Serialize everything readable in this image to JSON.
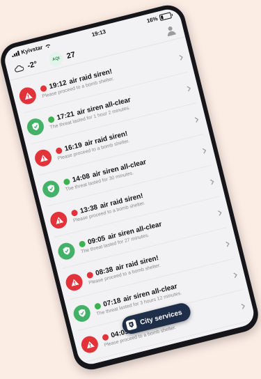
{
  "status": {
    "carrier": "Kyivstar",
    "time": "19:13",
    "battery": "16%"
  },
  "header": {
    "temperature": "-2°",
    "aqi_label": "AQI",
    "aqi_value": "27"
  },
  "alerts": [
    {
      "kind": "siren",
      "time": "19:12",
      "title": "air raid siren!",
      "subtitle": "Please proceed to a bomb shelter."
    },
    {
      "kind": "clear",
      "time": "17:21",
      "title": "air siren all-clear",
      "subtitle": "The threat lasted for 1 hour 2 minutes."
    },
    {
      "kind": "siren",
      "time": "16:19",
      "title": "air raid siren!",
      "subtitle": "Please proceed to a bomb shelter."
    },
    {
      "kind": "clear",
      "time": "14:08",
      "title": "air siren all-clear",
      "subtitle": "The threat lasted for 30 minutes."
    },
    {
      "kind": "siren",
      "time": "13:38",
      "title": "air raid siren!",
      "subtitle": "Please proceed to a bomb shelter."
    },
    {
      "kind": "clear",
      "time": "09:05",
      "title": "air siren all-clear",
      "subtitle": "The threat lasted for 27 minutes."
    },
    {
      "kind": "siren",
      "time": "08:38",
      "title": "air raid siren!",
      "subtitle": "Please proceed to a bomb shelter."
    },
    {
      "kind": "clear",
      "time": "07:18",
      "title": "air siren all-clear",
      "subtitle": "The threat lasted for 3 hours 12 minutes."
    },
    {
      "kind": "siren",
      "time": "04:05",
      "title": "air raid siren!",
      "subtitle": "Please proceed to a bomb shelter."
    }
  ],
  "fab": {
    "label": "City services"
  },
  "colors": {
    "siren_red": "#e2323a",
    "clear_green": "#43b167",
    "fab_bg": "#1f2f4a",
    "page_bg": "#fbece4"
  },
  "icons": {
    "cloud": "cloud-icon",
    "profile": "profile-icon",
    "siren": "warning-triangle-icon",
    "clear": "shield-check-icon",
    "chevron": "chevron-right-icon"
  }
}
